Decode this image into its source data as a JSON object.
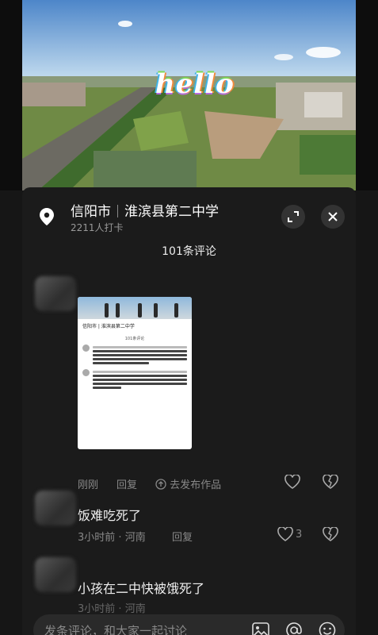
{
  "video": {
    "overlay_text": "hello"
  },
  "location": {
    "city": "信阳市",
    "place": "淮滨县第二中学",
    "checkins": "2211人打卡"
  },
  "comments_header": {
    "count_label": "101条评论"
  },
  "comments": [
    {
      "image_preview": {
        "city": "信阳市",
        "place": "淮滨县第二中学",
        "count_label": "101条评论"
      },
      "time": "刚刚",
      "reply_label": "回复",
      "publish_label": "去发布作品"
    },
    {
      "text": "饭难吃死了",
      "time": "3小时前",
      "region": "河南",
      "reply_label": "回复",
      "likes": "3"
    },
    {
      "text": "小孩在二中快被饿死了",
      "time": "3小时前",
      "region": "河南"
    }
  ],
  "input": {
    "placeholder": "发条评论，和大家一起讨论"
  },
  "icons": [
    "location-pin-icon",
    "expand-icon",
    "close-icon",
    "heart-icon",
    "broken-heart-icon",
    "upload-icon",
    "image-icon",
    "at-icon",
    "emoji-icon"
  ]
}
